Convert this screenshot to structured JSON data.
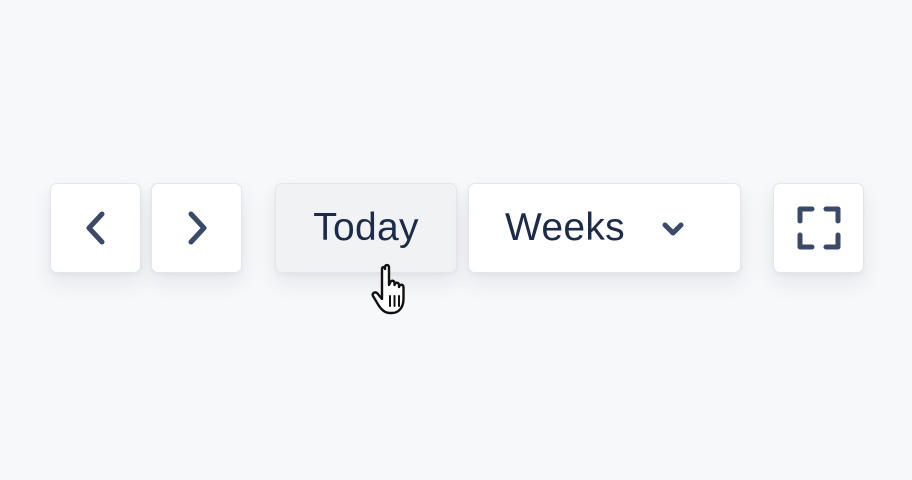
{
  "toolbar": {
    "prev_icon": "chevron-left-icon",
    "next_icon": "chevron-right-icon",
    "today_label": "Today",
    "view_selected": "Weeks",
    "view_dropdown_icon": "chevron-down-icon",
    "fullscreen_icon": "fullscreen-icon"
  },
  "colors": {
    "background": "#f7f8fa",
    "button_bg": "#ffffff",
    "button_hover_bg": "#f1f2f4",
    "text": "#1d2b4a",
    "icon": "#3a4a68"
  },
  "cursor": "pointer-hand-icon"
}
